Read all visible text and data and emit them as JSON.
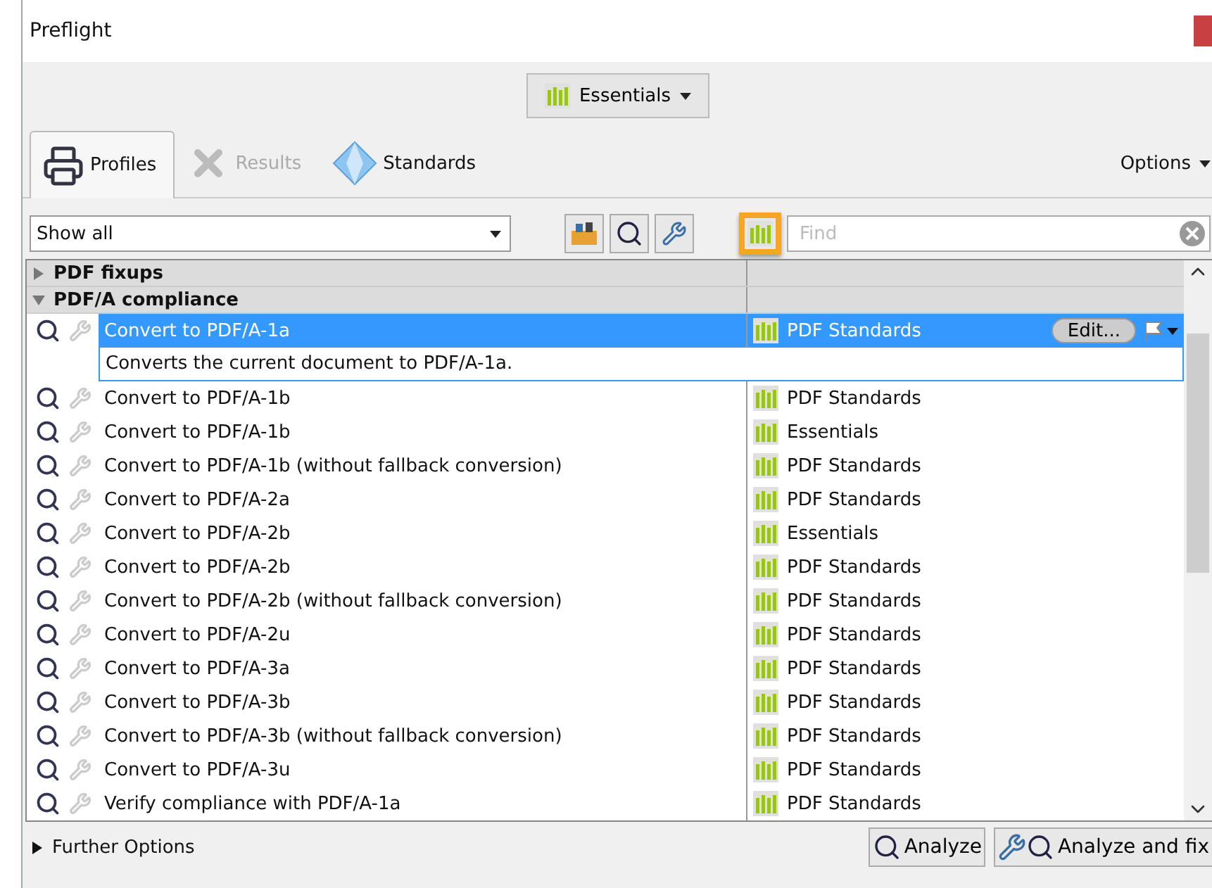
{
  "window": {
    "title": "Preflight"
  },
  "profile_set": {
    "label": "Essentials"
  },
  "tabs": [
    {
      "label": "Profiles",
      "selected": true,
      "disabled": false,
      "kind": "printer"
    },
    {
      "label": "Results",
      "selected": false,
      "disabled": true,
      "kind": "results"
    },
    {
      "label": "Standards",
      "selected": false,
      "disabled": false,
      "kind": "diamond"
    }
  ],
  "options": {
    "label": "Options"
  },
  "filter": {
    "value": "Show all"
  },
  "library_filter": {
    "highlighted": true
  },
  "find": {
    "placeholder": "Find"
  },
  "groups": [
    {
      "label": "PDF fixups",
      "expanded": false
    },
    {
      "label": "PDF/A compliance",
      "expanded": true
    }
  ],
  "profiles": [
    {
      "name": "Convert to PDF/A-1a",
      "library": "PDF Standards",
      "selected": true,
      "description": "Converts the current document to PDF/A-1a.",
      "edit": "Edit..."
    },
    {
      "name": "Convert to PDF/A-1b",
      "library": "PDF Standards",
      "selected": false
    },
    {
      "name": "Convert to PDF/A-1b",
      "library": "Essentials",
      "selected": false
    },
    {
      "name": "Convert to PDF/A-1b (without fallback conversion)",
      "library": "PDF Standards",
      "selected": false
    },
    {
      "name": "Convert to PDF/A-2a",
      "library": "PDF Standards",
      "selected": false
    },
    {
      "name": "Convert to PDF/A-2b",
      "library": "Essentials",
      "selected": false
    },
    {
      "name": "Convert to PDF/A-2b",
      "library": "PDF Standards",
      "selected": false
    },
    {
      "name": "Convert to PDF/A-2b (without fallback conversion)",
      "library": "PDF Standards",
      "selected": false
    },
    {
      "name": "Convert to PDF/A-2u",
      "library": "PDF Standards",
      "selected": false
    },
    {
      "name": "Convert to PDF/A-3a",
      "library": "PDF Standards",
      "selected": false
    },
    {
      "name": "Convert to PDF/A-3b",
      "library": "PDF Standards",
      "selected": false
    },
    {
      "name": "Convert to PDF/A-3b (without fallback conversion)",
      "library": "PDF Standards",
      "selected": false
    },
    {
      "name": "Convert to PDF/A-3u",
      "library": "PDF Standards",
      "selected": false
    },
    {
      "name": "Verify compliance with PDF/A-1a",
      "library": "PDF Standards",
      "selected": false
    }
  ],
  "further_options": {
    "label": "Further Options",
    "expanded": false
  },
  "buttons": [
    {
      "label": "Analyze",
      "kind": "analyze"
    },
    {
      "label": "Analyze and fix",
      "kind": "fix"
    }
  ]
}
